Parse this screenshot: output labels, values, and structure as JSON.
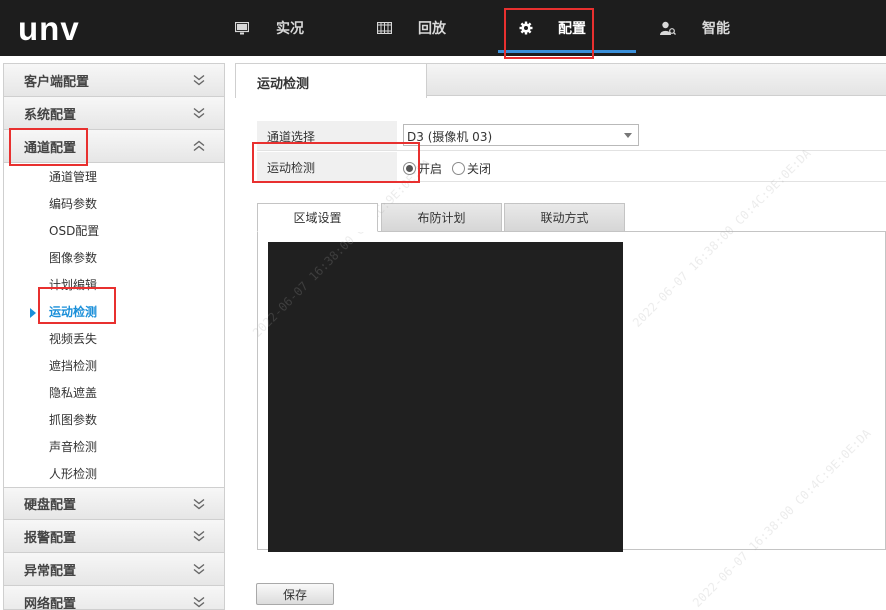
{
  "header": {
    "logo": "unv",
    "nav": [
      {
        "label": "实况",
        "icon": "monitor-icon"
      },
      {
        "label": "回放",
        "icon": "film-strip-icon"
      },
      {
        "label": "配置",
        "icon": "gear-icon",
        "active": true
      },
      {
        "label": "智能",
        "icon": "person-search-icon"
      }
    ]
  },
  "sidebar": {
    "groups_top": [
      {
        "label": "客户端配置",
        "state": "collapsed"
      },
      {
        "label": "系统配置",
        "state": "collapsed"
      }
    ],
    "expanded_group": {
      "label": "通道配置",
      "state": "expanded",
      "items": [
        "通道管理",
        "编码参数",
        "OSD配置",
        "图像参数",
        "计划编辑",
        "运动检测",
        "视频丢失",
        "遮挡检测",
        "隐私遮盖",
        "抓图参数",
        "声音检测",
        "人形检测"
      ],
      "active_item": "运动检测"
    },
    "groups_bottom": [
      {
        "label": "硬盘配置",
        "state": "collapsed"
      },
      {
        "label": "报警配置",
        "state": "collapsed"
      },
      {
        "label": "异常配置",
        "state": "collapsed"
      },
      {
        "label": "网络配置",
        "state": "collapsed"
      }
    ]
  },
  "main": {
    "tab_title": "运动检测",
    "channel_label": "通道选择",
    "channel_value": "D3 (摄像机 03)",
    "motion_label": "运动检测",
    "radio_on": "开启",
    "radio_off": "关闭",
    "motion_enabled": true,
    "subtabs": [
      "区域设置",
      "布防计划",
      "联动方式"
    ],
    "active_subtab": "区域设置",
    "save_label": "保存"
  },
  "watermark": {
    "text": "2022-06-07 16:38:00 C0:4C:9E:0E:DA"
  },
  "colors": {
    "header_bg": "#1d1d1d",
    "accent": "#1a8fd9",
    "highlight_box": "#e8302f",
    "video_bg": "#202020"
  }
}
